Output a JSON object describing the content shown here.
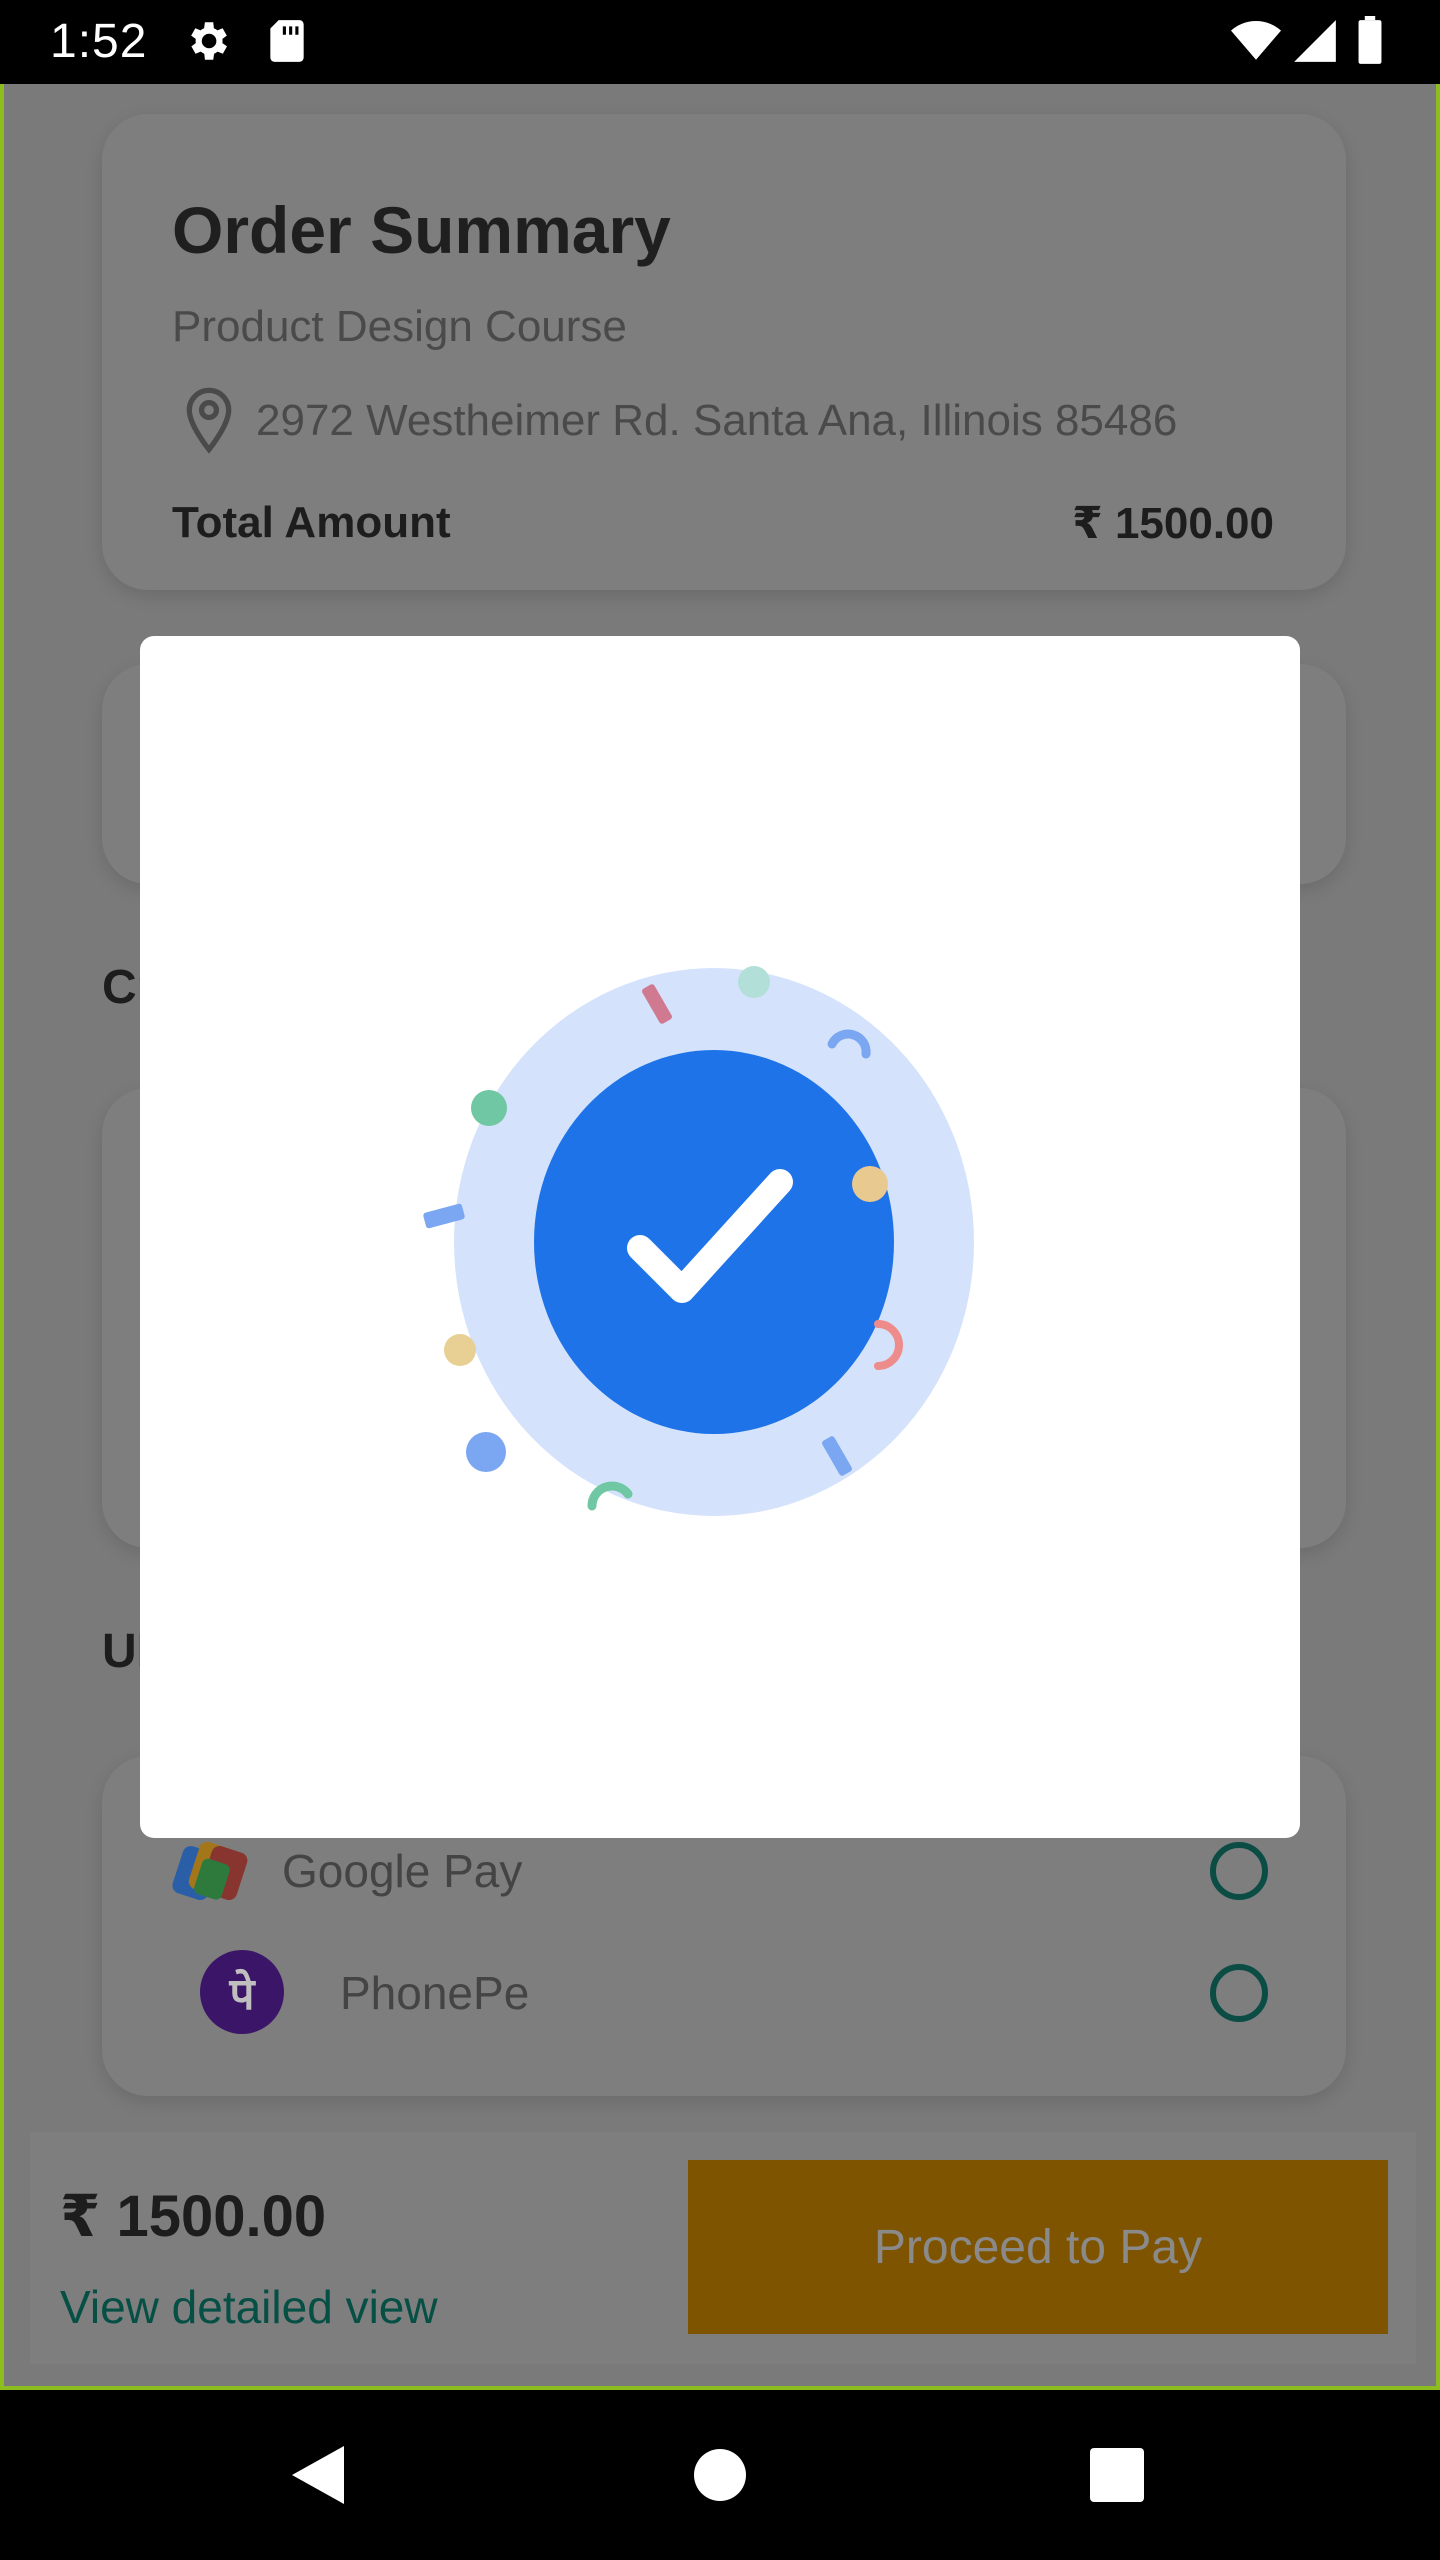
{
  "status_bar": {
    "time": "1:52",
    "icons": [
      "gear-icon",
      "sd-card-icon",
      "wifi-icon",
      "signal-icon",
      "battery-icon"
    ]
  },
  "order_summary": {
    "title": "Order Summary",
    "course": "Product Design Course",
    "address": "2972 Westheimer Rd. Santa Ana, Illinois 85486",
    "total_label": "Total Amount",
    "total_value": "₹ 1500.00"
  },
  "sections": {
    "credit_heading_partial": "Cr",
    "upi_heading_partial": "UI"
  },
  "upi": {
    "options": [
      {
        "name": "Google Pay",
        "icon": "google-pay-icon"
      },
      {
        "name": "PhonePe",
        "icon": "phonepe-icon",
        "glyph": "पे"
      }
    ]
  },
  "bottom_bar": {
    "price": "₹ 1500.00",
    "detail_link": "View detailed view",
    "pay_button": "Proceed to Pay"
  },
  "modal": {
    "graphic": "success-check-icon"
  },
  "colors": {
    "accent_blue": "#1f73e8",
    "check_halo": "#d4e3fb",
    "overlay": "#7a7a7a",
    "pay_button": "#7f5400",
    "link": "#064f45"
  },
  "navigation": [
    "back-icon",
    "home-icon",
    "recents-icon"
  ]
}
